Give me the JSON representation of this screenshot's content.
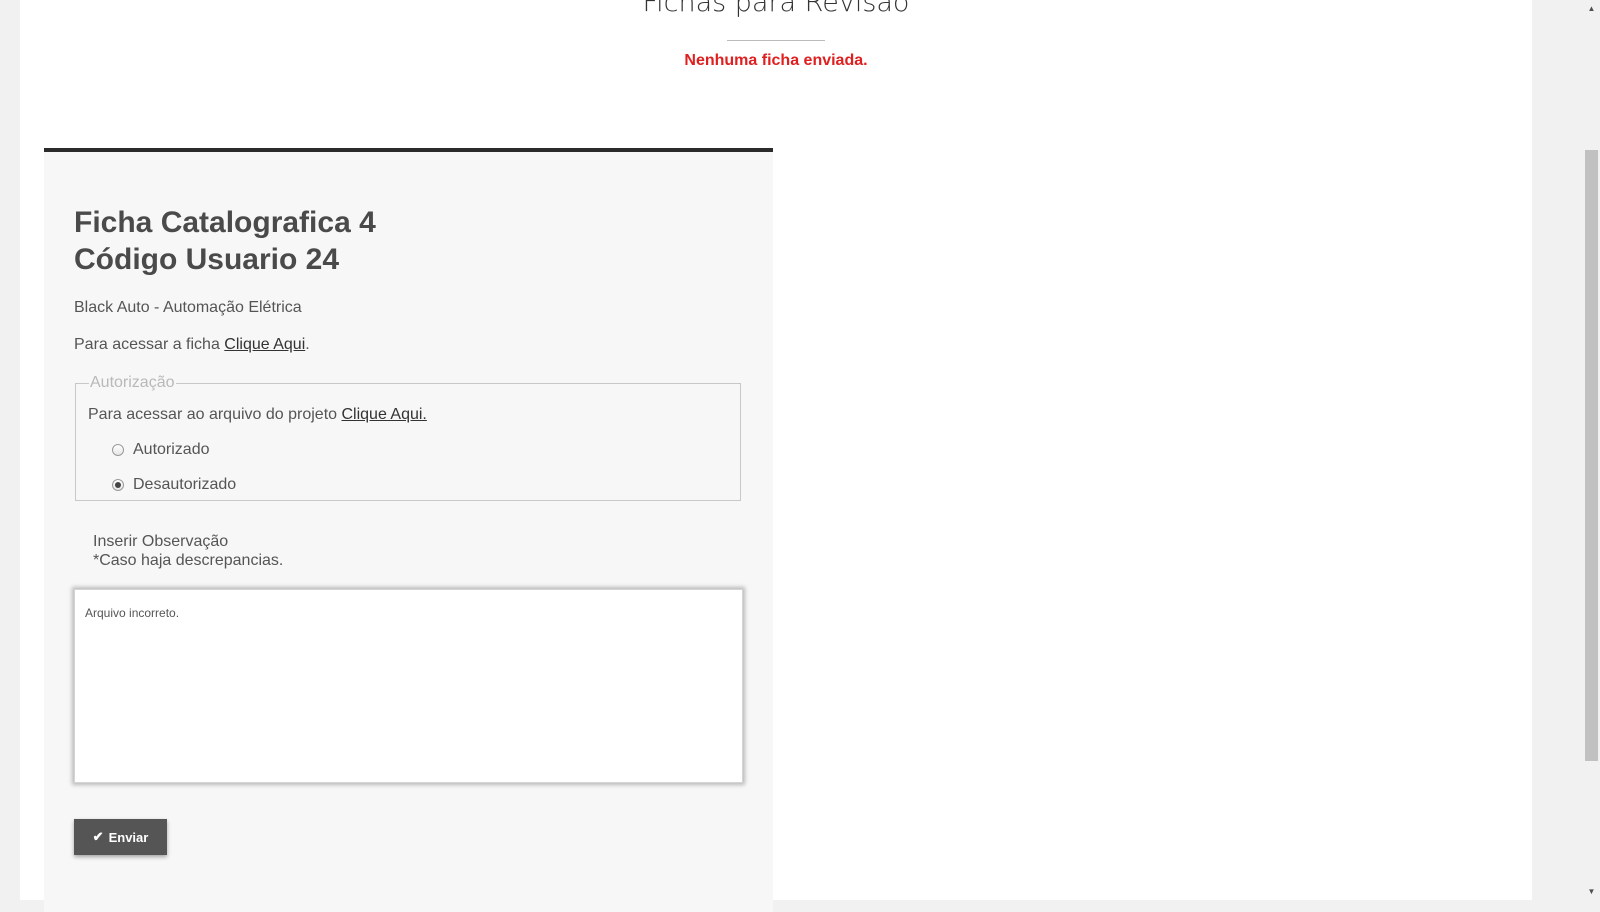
{
  "header": {
    "title": "Fichas para Revisão",
    "status_message": "Nenhuma ficha enviada."
  },
  "card": {
    "title_line1": "Ficha Catalografica 4",
    "title_line2": "Código Usuario 24",
    "company": "Black Auto - Automação Elétrica",
    "access_prefix": "Para acessar a ficha ",
    "access_link": "Clique Aqui",
    "access_suffix": ".",
    "authorization": {
      "legend": "Autorização",
      "project_prefix": "Para acessar ao arquivo do projeto ",
      "project_link": "Clique Aqui.",
      "options": [
        {
          "label": "Autorizado",
          "checked": false
        },
        {
          "label": "Desautorizado",
          "checked": true
        }
      ]
    },
    "observation": {
      "label_line1": "Inserir Observação",
      "label_line2": "*Caso haja descrepancias.",
      "value": "Arquivo incorreto."
    },
    "submit_label": "Enviar"
  },
  "icons": {
    "submit": "check-icon",
    "scroll_up": "scroll-up-arrow-icon",
    "scroll_down": "scroll-down-arrow-icon"
  },
  "colors": {
    "status_message": "#e02020",
    "card_border": "#2b2b2b",
    "button_bg": "#555555"
  }
}
